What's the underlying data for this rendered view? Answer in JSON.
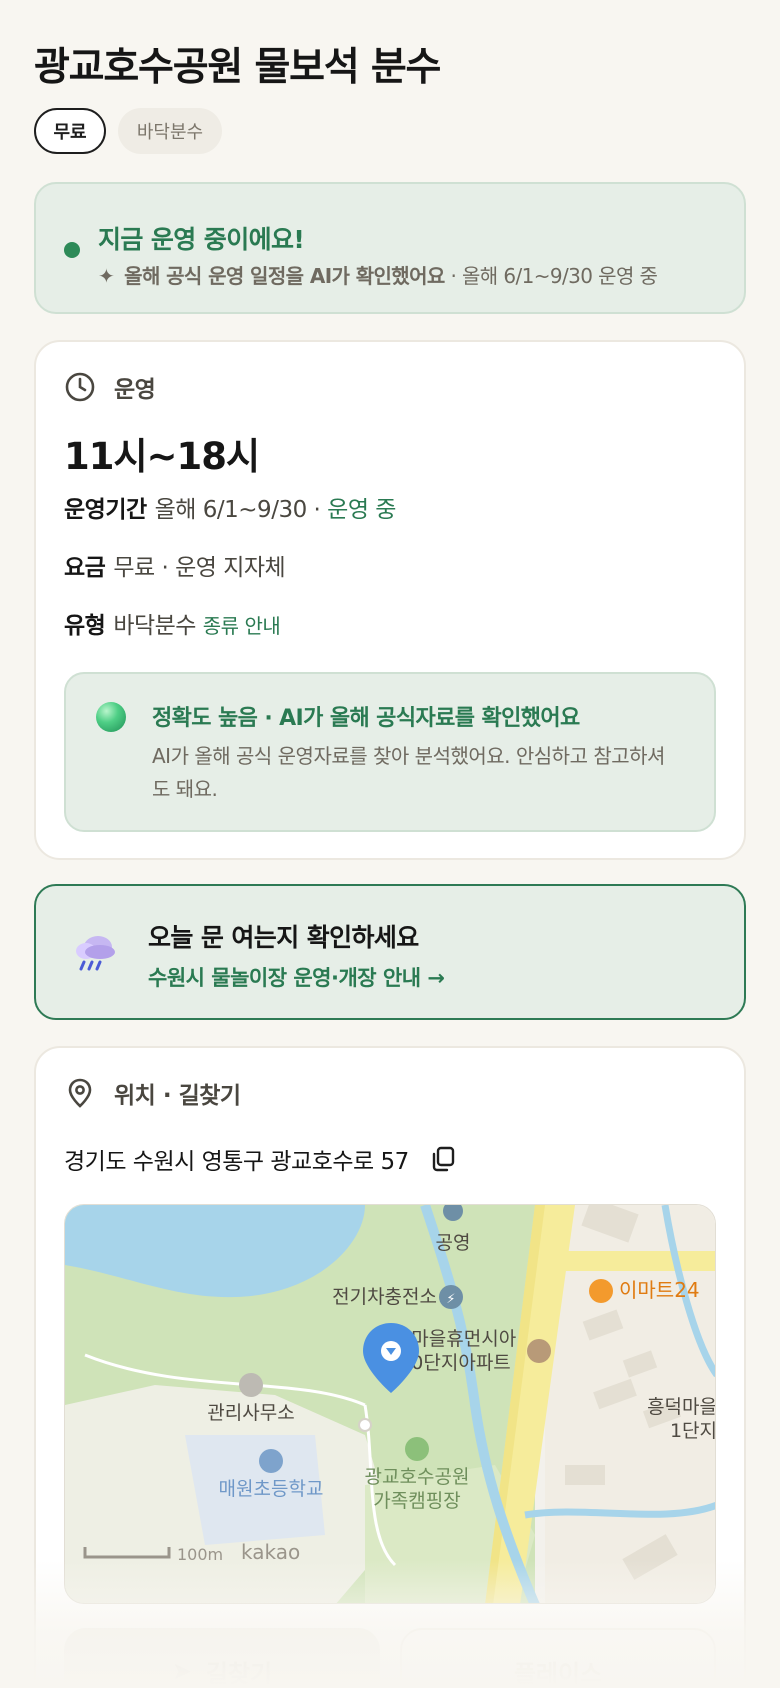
{
  "header": {
    "title": "광교호수공원 물보석 분수",
    "chips": [
      "무료",
      "바닥분수"
    ]
  },
  "status": {
    "title": "지금 운영 중이에요!",
    "sub_strong": "올해 공식 운영 일정을 AI가 확인했어요",
    "sub_rest": " · 올해 6/1~9/30 운영 중"
  },
  "operation": {
    "section_label": "운영",
    "hours": "11시~18시",
    "period_key": "운영기간",
    "period_value": "올해 6/1~9/30 ·",
    "period_status": " 운영 중",
    "fee_key": "요금",
    "fee_value": "무료 · 운영 지자체",
    "type_key": "유형",
    "type_value": "바닥분수",
    "type_link": "종류 안내",
    "accuracy_title": "정확도 높음 · AI가 올해 공식자료를 확인했어요",
    "accuracy_body": "AI가 올해 공식 운영자료를 찾아 분석했어요. 안심하고 참고하셔도 돼요."
  },
  "notice": {
    "title": "오늘 문 여는지 확인하세요",
    "link": "수원시 물놀이장 운영·개장 안내 →"
  },
  "location": {
    "section_label": "위치 · 길찾기",
    "address": "경기도 수원시 영통구 광교호수로 57",
    "map_labels": {
      "parking": "공영",
      "ev": "전기차충전소",
      "emart": "이마트24",
      "apt1": "한마을휴먼시아",
      "apt2": "20단지아파트",
      "office": "관리사무소",
      "school": "매원초등학교",
      "camp1": "광교호수공원",
      "camp2": "가족캠핑장",
      "heungdeok1": "흥덕마을",
      "heungdeok2": "1단지",
      "scale": "100m",
      "brand": "kakao"
    },
    "btn_directions": "길찾기",
    "btn_place": "플레이스"
  },
  "colors": {
    "accent_green": "#2a7a52",
    "status_bg": "#e6eee7",
    "pin_blue": "#4a90e2"
  }
}
